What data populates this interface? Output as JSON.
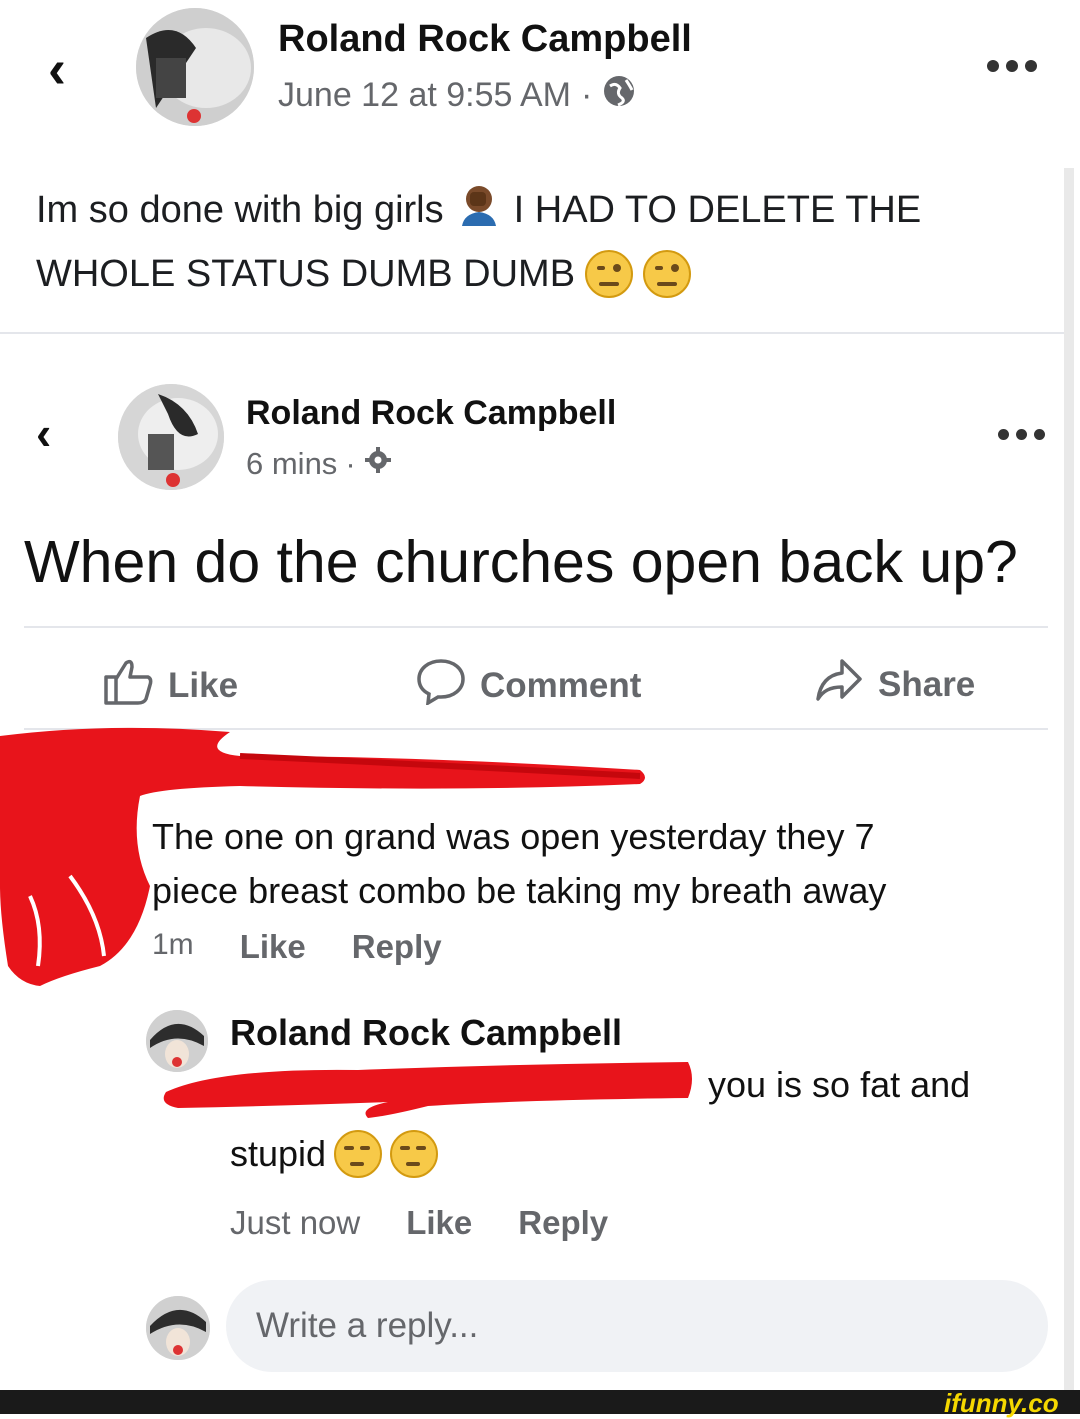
{
  "post": {
    "author": "Roland Rock Campbell",
    "timestamp": "June 12 at 9:55 AM",
    "separator": "·",
    "text_line1": "Im so done with big girls",
    "text_line1_tail": "I HAD TO DELETE THE",
    "text_line2": "WHOLE STATUS DUMB DUMB"
  },
  "shared": {
    "author": "Roland Rock Campbell",
    "timestamp": "6 mins",
    "separator": "·",
    "text": "When do the churches open back up?",
    "actions": {
      "like": "Like",
      "comment": "Comment",
      "share": "Share"
    }
  },
  "comment": {
    "line1": "The one on grand was open yesterday they 7",
    "line2": "piece breast combo be taking my breath away",
    "time": "1m",
    "like": "Like",
    "reply": "Reply"
  },
  "reply": {
    "author": "Roland Rock Campbell",
    "line1_tail": "you is so fat and",
    "line2": "stupid",
    "time": "Just now",
    "like": "Like",
    "reply": "Reply"
  },
  "composer": {
    "placeholder": "Write a reply..."
  },
  "watermark": "ifunny.co",
  "colors": {
    "redaction": "#e8141b",
    "meta": "#65676b",
    "bottom_bar": "#1a1a1a",
    "watermark": "#f5d800"
  }
}
